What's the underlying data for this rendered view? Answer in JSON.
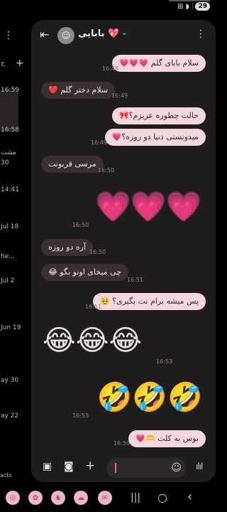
{
  "status": {
    "icons": "⊞ ◗ ⫶",
    "battery": "29"
  },
  "background_list": {
    "letters": "ج",
    "times": [
      "16:59",
      "16:58",
      "مشت",
      "30",
      "14:41",
      "Jul 18",
      "he...",
      "Jul 2",
      "Jun 19",
      "ay 30",
      "ay 22"
    ],
    "bottom_text": "acts"
  },
  "header": {
    "back_glyph": "⇤",
    "avatar_glyph": "☺",
    "name": "بابایی 💖",
    "caret": "⌄",
    "menu_glyph": "⋮"
  },
  "messages": [
    {
      "text": "سلام بابای گلم 💗💗💗",
      "time": "16:48",
      "dir": "out"
    },
    {
      "text": "سلام دختر گلم ❤️",
      "time": "16:49",
      "dir": "in"
    },
    {
      "text": "حالت چطوره عزیزم؟🎀",
      "time": "",
      "dir": "out"
    },
    {
      "text": "میدونستی دنیا دو روزه؟💗",
      "time": "16:49",
      "dir": "out"
    },
    {
      "text": "مرسی قربونت",
      "time": "16:50",
      "dir": "in"
    },
    {
      "text": "💗💗💗",
      "time": "16:50",
      "dir": "out-emoji"
    },
    {
      "text": "آره دو روزه",
      "time": "16:50",
      "dir": "in"
    },
    {
      "text": "چی میخای اونو بگو 😂",
      "time": "16:51",
      "dir": "in"
    },
    {
      "text": "پس میشه برام نت بگیری؟ 🥹",
      "time": "16:51",
      "dir": "out"
    },
    {
      "text": "😂😂😂",
      "time": "16:53",
      "dir": "in-emoji"
    },
    {
      "text": "🤣🤣🤣",
      "time": "16:53",
      "dir": "out-emoji"
    },
    {
      "text": "بوس به کلت 🫶💗",
      "time": "16:59",
      "dir": "out"
    }
  ],
  "composer": {
    "gallery_glyph": "▣",
    "camera_glyph": "◙",
    "plus_glyph": "+",
    "smile_glyph": "☺",
    "voice_glyph": "ılıl"
  },
  "dock": {
    "apps": [
      "◎",
      "✿",
      "♞",
      "☁",
      "✉"
    ]
  },
  "nav": {
    "recent": "|||",
    "home": "○",
    "back": "‹"
  }
}
